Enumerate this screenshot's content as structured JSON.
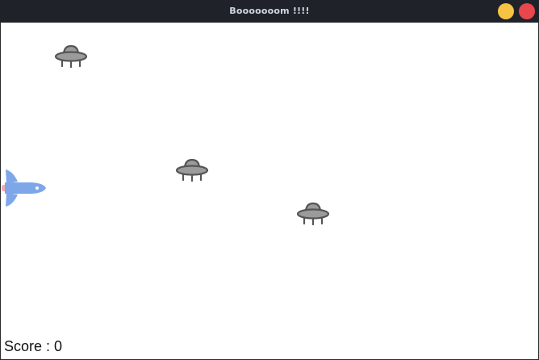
{
  "window": {
    "title": "Booooooom !!!!",
    "titlebar_color": "#1f2329",
    "minimize_color": "#f6c344",
    "close_color": "#e9464e"
  },
  "game": {
    "background_color": "#ffffff",
    "player": {
      "icon": "spaceship-icon",
      "color": "#7ea7ea"
    },
    "enemies": [
      {
        "icon": "ufo-icon",
        "color": "#8a8a8a"
      },
      {
        "icon": "ufo-icon",
        "color": "#8a8a8a"
      },
      {
        "icon": "ufo-icon",
        "color": "#8a8a8a"
      }
    ],
    "score_text": "Score : 0"
  }
}
